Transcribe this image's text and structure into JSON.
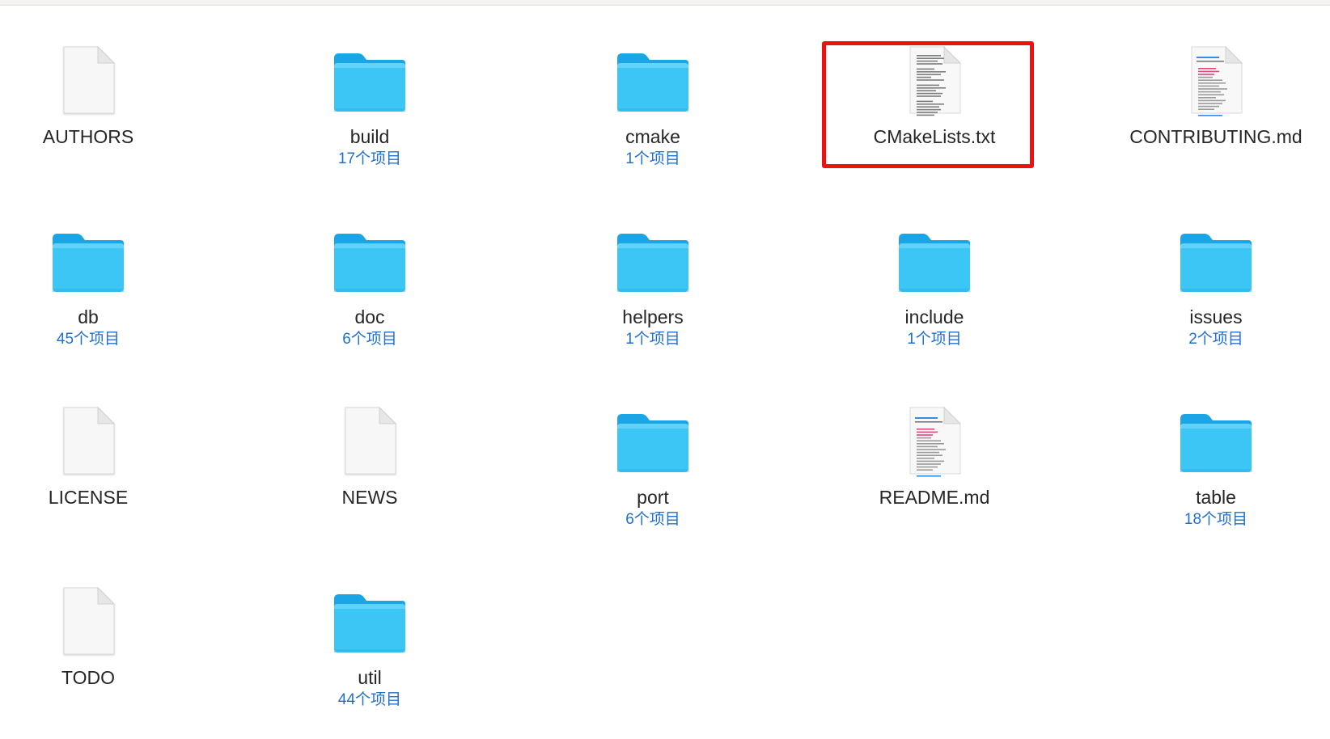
{
  "window": {
    "view": "icon-view",
    "count_color": "#1f6fd0",
    "folder_color": "#3cc6f5",
    "highlight_color": "#ee1111"
  },
  "items": [
    {
      "name": "AUTHORS",
      "count": "",
      "type": "document",
      "icon": "plain-document-icon"
    },
    {
      "name": "build",
      "count": "17个项目",
      "type": "folder",
      "icon": "folder-icon"
    },
    {
      "name": "cmake",
      "count": "1个项目",
      "type": "folder",
      "icon": "folder-icon"
    },
    {
      "name": "CMakeLists.txt",
      "count": "",
      "type": "text",
      "icon": "text-document-icon",
      "highlighted": true
    },
    {
      "name": "CONTRIBUTING.md",
      "count": "",
      "type": "markdown",
      "icon": "markdown-document-icon"
    },
    {
      "name": "db",
      "count": "45个项目",
      "type": "folder",
      "icon": "folder-icon"
    },
    {
      "name": "doc",
      "count": "6个项目",
      "type": "folder",
      "icon": "folder-icon"
    },
    {
      "name": "helpers",
      "count": "1个项目",
      "type": "folder",
      "icon": "folder-icon"
    },
    {
      "name": "include",
      "count": "1个项目",
      "type": "folder",
      "icon": "folder-icon"
    },
    {
      "name": "issues",
      "count": "2个项目",
      "type": "folder",
      "icon": "folder-icon"
    },
    {
      "name": "LICENSE",
      "count": "",
      "type": "document",
      "icon": "plain-document-icon"
    },
    {
      "name": "NEWS",
      "count": "",
      "type": "document",
      "icon": "plain-document-icon"
    },
    {
      "name": "port",
      "count": "6个项目",
      "type": "folder",
      "icon": "folder-icon"
    },
    {
      "name": "README.md",
      "count": "",
      "type": "markdown",
      "icon": "markdown-document-icon"
    },
    {
      "name": "table",
      "count": "18个项目",
      "type": "folder",
      "icon": "folder-icon"
    },
    {
      "name": "TODO",
      "count": "",
      "type": "document",
      "icon": "plain-document-icon"
    },
    {
      "name": "util",
      "count": "44个项目",
      "type": "folder",
      "icon": "folder-icon"
    }
  ]
}
